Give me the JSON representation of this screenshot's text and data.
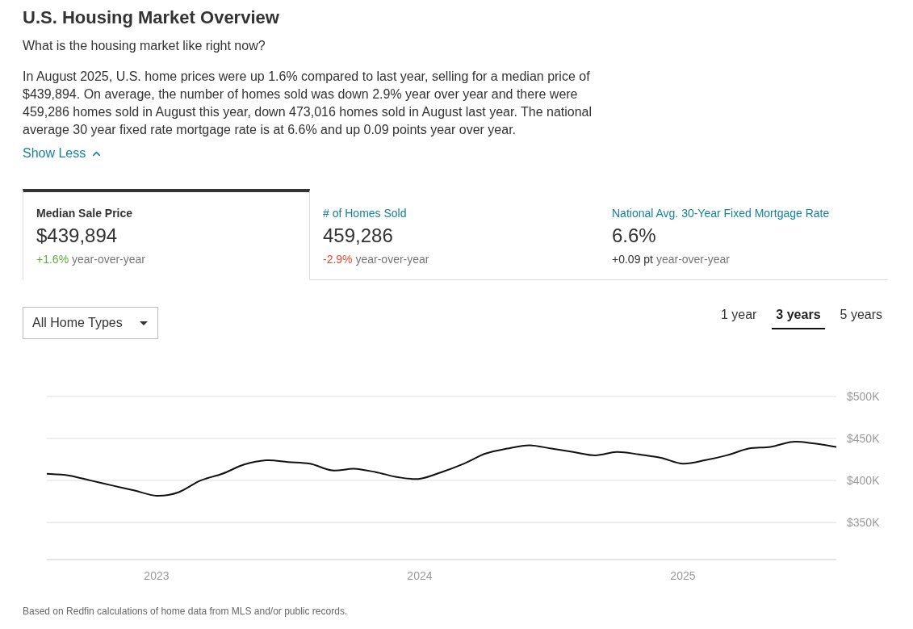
{
  "header": {
    "title": "U.S. Housing Market Overview",
    "subtitle": "What is the housing market like right now?",
    "summary": "In August 2025, U.S. home prices were up 1.6% compared to last year, selling for a median price of $439,894. On average, the number of homes sold was down 2.9% year over year and there were 459,286 homes sold in August this year, down 473,016 homes sold in August last year. The national average 30 year fixed rate mortgage rate is at 6.6% and up 0.09 points year over year.",
    "toggle": {
      "label": "Show Less",
      "expanded": true
    }
  },
  "metric_tabs": [
    {
      "label": "Median Sale Price",
      "value": "$439,894",
      "change": "+1.6%",
      "color": "#5fae3a",
      "change_note": "year-over-year",
      "selected": true
    },
    {
      "label": "# of Homes Sold",
      "value": "459,286",
      "change": "-2.9%",
      "color": "#ef4a2f",
      "change_note": "year-over-year",
      "selected": false
    },
    {
      "label": "National Avg. 30-Year Fixed Mortgage Rate",
      "value": "6.6%",
      "change": "+0.09 pt",
      "color": "#333333",
      "change_note": "year-over-year",
      "selected": false
    }
  ],
  "home_type_dropdown": {
    "value": "All Home Types"
  },
  "range_tabs": [
    {
      "label": "1 year",
      "selected": false
    },
    {
      "label": "3 years",
      "selected": true
    },
    {
      "label": "5 years",
      "selected": false
    }
  ],
  "chart": {
    "chart_data": {
      "type": "line",
      "grid": true,
      "x": [
        2022.583,
        2022.667,
        2022.75,
        2022.833,
        2022.917,
        2023,
        2023.083,
        2023.167,
        2023.25,
        2023.333,
        2023.417,
        2023.5,
        2023.583,
        2023.667,
        2023.75,
        2023.833,
        2023.917,
        2024,
        2024.083,
        2024.167,
        2024.25,
        2024.333,
        2024.417,
        2024.5,
        2024.583,
        2024.667,
        2024.75,
        2024.833,
        2024.917,
        2025,
        2025.083,
        2025.167,
        2025.25,
        2025.333,
        2025.417,
        2025.5,
        2025.583
      ],
      "series": [
        {
          "color": "#111111",
          "values": [
            408000,
            406000,
            400000,
            394000,
            388000,
            382000,
            386000,
            400000,
            408000,
            419000,
            424000,
            422000,
            420000,
            412000,
            414000,
            410000,
            404000,
            402000,
            410000,
            420000,
            432000,
            438000,
            442000,
            438000,
            434000,
            430000,
            434000,
            431000,
            427000,
            420000,
            424000,
            430000,
            438000,
            440000,
            446000,
            444000,
            440000
          ]
        }
      ],
      "xlim": [
        2022.583,
        2025.583
      ],
      "ylim": [
        306000,
        500000
      ],
      "xticks": [
        {
          "value": 2023,
          "label": "2023"
        },
        {
          "value": 2024,
          "label": "2024"
        },
        {
          "value": 2025,
          "label": "2025"
        }
      ],
      "yticks": [
        {
          "value": 350000,
          "label": "$350K"
        },
        {
          "value": 400000,
          "label": "$400K"
        },
        {
          "value": 450000,
          "label": "$450K"
        },
        {
          "value": 500000,
          "label": "$500K"
        }
      ]
    }
  },
  "footnote": "Based on Redfin calculations of home data from MLS and/or public records."
}
